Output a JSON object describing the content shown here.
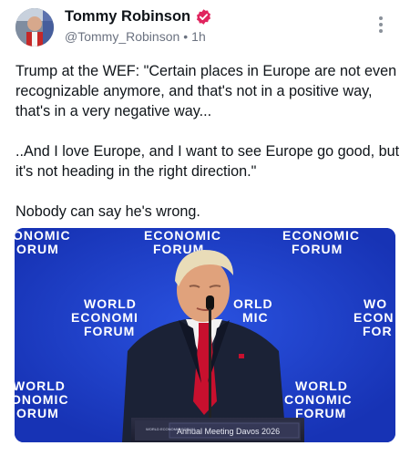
{
  "post": {
    "author_name": "Tommy Robinson",
    "handle": "@Tommy_Robinson",
    "separator": "•",
    "timestamp": "1h",
    "text": "Trump at the WEF: \"Certain places in Europe are not even recognizable anymore, and that's not in a positive way, that's in a very negative way...\n\n..And I love Europe, and I want to see Europe go good, but it's not heading in the right direction.\"\n\nNobody can say he's wrong."
  },
  "media": {
    "backdrop": {
      "line1": "ECONOMIC",
      "line2": "FORUM",
      "line_world": "WORLD",
      "line_economic": "ECONOMIC",
      "line_forum": "FORUM",
      "frag_onomic": "ONOMIC",
      "frag_orum": "ORUM",
      "frag_world": "WORLD",
      "frag_onomic2": "ONOMIC",
      "frag_wo": "WO",
      "frag_econ": "ECON",
      "frag_for": "FOR",
      "frag_orld": "ORLD",
      "frag_mic": "MIC",
      "frag_econom": "ECONOMI",
      "frag_conomic": "CONOMIC"
    },
    "podium_sign": "Annual Meeting Davos 2026",
    "podium_logo": "WORLD ECONOMIC FORUM"
  },
  "colors": {
    "backdrop_blue": "#1c3ec9",
    "verified_pink": "#e0245e",
    "suit": "#1b2236",
    "tie": "#c8102e"
  }
}
